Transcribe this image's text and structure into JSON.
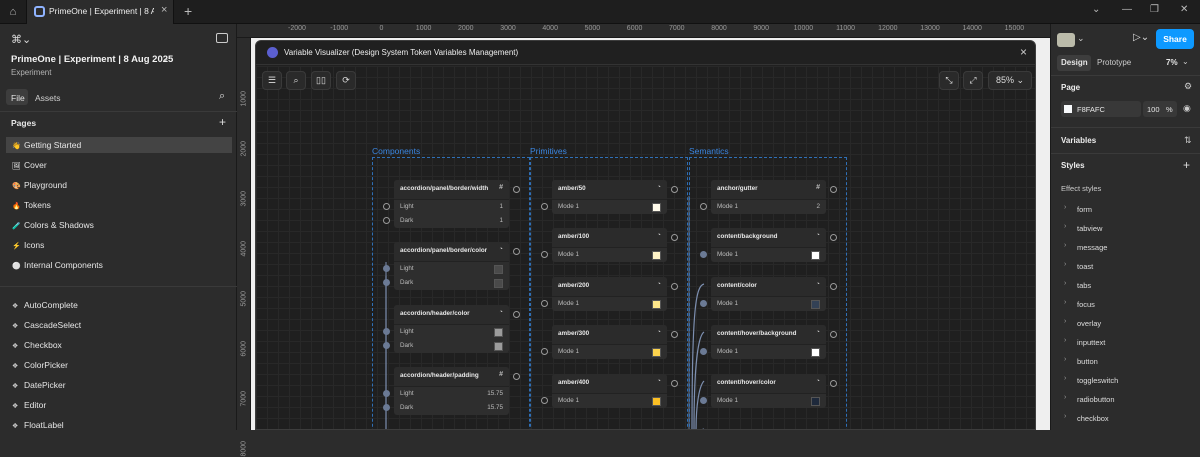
{
  "tab": {
    "title": "PrimeOne | Experiment | 8 Aug 2025"
  },
  "window": {
    "minimize": "—",
    "restore": "❐",
    "close": "✕"
  },
  "left": {
    "project": "PrimeOne | Experiment | 8 Aug 2025",
    "subtitle": "Experiment",
    "tabs": [
      "File",
      "Assets"
    ],
    "pages_title": "Pages",
    "pages": [
      {
        "icon": "👋",
        "label": "Getting Started"
      },
      {
        "icon": "🖼",
        "label": "Cover"
      },
      {
        "icon": "🎨",
        "label": "Playground"
      },
      {
        "icon": "🔥",
        "label": "Tokens"
      },
      {
        "icon": "🧪",
        "label": "Colors & Shadows"
      },
      {
        "icon": "⚡",
        "label": "Icons"
      },
      {
        "icon": "⚪",
        "label": "Internal Components"
      }
    ],
    "components": [
      {
        "icon": "❖",
        "label": "AutoComplete"
      },
      {
        "icon": "❖",
        "label": "CascadeSelect"
      },
      {
        "icon": "❖",
        "label": "Checkbox"
      },
      {
        "icon": "❖",
        "label": "ColorPicker"
      },
      {
        "icon": "❖",
        "label": "DatePicker"
      },
      {
        "icon": "❖",
        "label": "Editor"
      },
      {
        "icon": "❖",
        "label": "FloatLabel"
      }
    ]
  },
  "ruler": {
    "top": [
      "-2000",
      "-1000",
      "0",
      "1000",
      "2000",
      "3000",
      "4000",
      "5000",
      "6000",
      "7000",
      "8000",
      "9000",
      "10000",
      "11000",
      "12000",
      "13000",
      "14000",
      "15000"
    ],
    "left": [
      "1000",
      "2000",
      "3000",
      "4000",
      "5000",
      "6000",
      "7000",
      "8000"
    ]
  },
  "modal": {
    "title": "Variable Visualizer (Design System Token Variables Management)",
    "zoom": "85%",
    "groups": [
      "Components",
      "Primitives",
      "Semantics"
    ],
    "components": [
      {
        "name": "accordion/panel/border/width",
        "icon": "#",
        "rows": [
          {
            "label": "Light",
            "value": "1"
          },
          {
            "label": "Dark",
            "value": "1"
          }
        ]
      },
      {
        "name": "accordion/panel/border/color",
        "icon": "◔",
        "rows": [
          {
            "label": "Light",
            "swatch": "#4a4a4a"
          },
          {
            "label": "Dark",
            "swatch": "#4a4a4a"
          }
        ]
      },
      {
        "name": "accordion/header/color",
        "icon": "◔",
        "rows": [
          {
            "label": "Light",
            "swatch": "#9c9c9c"
          },
          {
            "label": "Dark",
            "swatch": "#9c9c9c"
          }
        ]
      },
      {
        "name": "accordion/header/padding",
        "icon": "#",
        "rows": [
          {
            "label": "Light",
            "value": "15.75"
          },
          {
            "label": "Dark",
            "value": "15.75"
          }
        ]
      }
    ],
    "primitives": [
      {
        "name": "amber/50",
        "icon": "◔",
        "rows": [
          {
            "label": "Mode 1",
            "swatch": "#fffbeb"
          }
        ]
      },
      {
        "name": "amber/100",
        "icon": "◔",
        "rows": [
          {
            "label": "Mode 1",
            "swatch": "#fef3c7"
          }
        ]
      },
      {
        "name": "amber/200",
        "icon": "◔",
        "rows": [
          {
            "label": "Mode 1",
            "swatch": "#fde68a"
          }
        ]
      },
      {
        "name": "amber/300",
        "icon": "◔",
        "rows": [
          {
            "label": "Mode 1",
            "swatch": "#fcd34d"
          }
        ]
      },
      {
        "name": "amber/400",
        "icon": "◔",
        "rows": [
          {
            "label": "Mode 1",
            "swatch": "#fbbf24"
          }
        ]
      }
    ],
    "semantics": [
      {
        "name": "anchor/gutter",
        "icon": "#",
        "rows": [
          {
            "label": "Mode 1",
            "value": "2"
          }
        ]
      },
      {
        "name": "content/background",
        "icon": "◔",
        "rows": [
          {
            "label": "Mode 1",
            "swatch": "#ffffff"
          }
        ]
      },
      {
        "name": "content/color",
        "icon": "◔",
        "rows": [
          {
            "label": "Mode 1",
            "swatch": "#334155"
          }
        ]
      },
      {
        "name": "content/hover/background",
        "icon": "◔",
        "rows": [
          {
            "label": "Mode 1",
            "swatch": "#ffffff"
          }
        ]
      },
      {
        "name": "content/hover/color",
        "icon": "◔",
        "rows": [
          {
            "label": "Mode 1",
            "swatch": "#1e293b"
          }
        ]
      }
    ]
  },
  "right": {
    "share": "Share",
    "tabs": [
      "Design",
      "Prototype"
    ],
    "zoom": "7%",
    "page_title": "Page",
    "page_color": "F8FAFC",
    "page_opacity": "100",
    "pct": "%",
    "variables": "Variables",
    "styles": "Styles",
    "effect_styles": "Effect styles",
    "effects": [
      "form",
      "tabview",
      "message",
      "toast",
      "tabs",
      "focus",
      "overlay",
      "inputtext",
      "button",
      "toggleswitch",
      "radiobutton",
      "checkbox"
    ]
  }
}
